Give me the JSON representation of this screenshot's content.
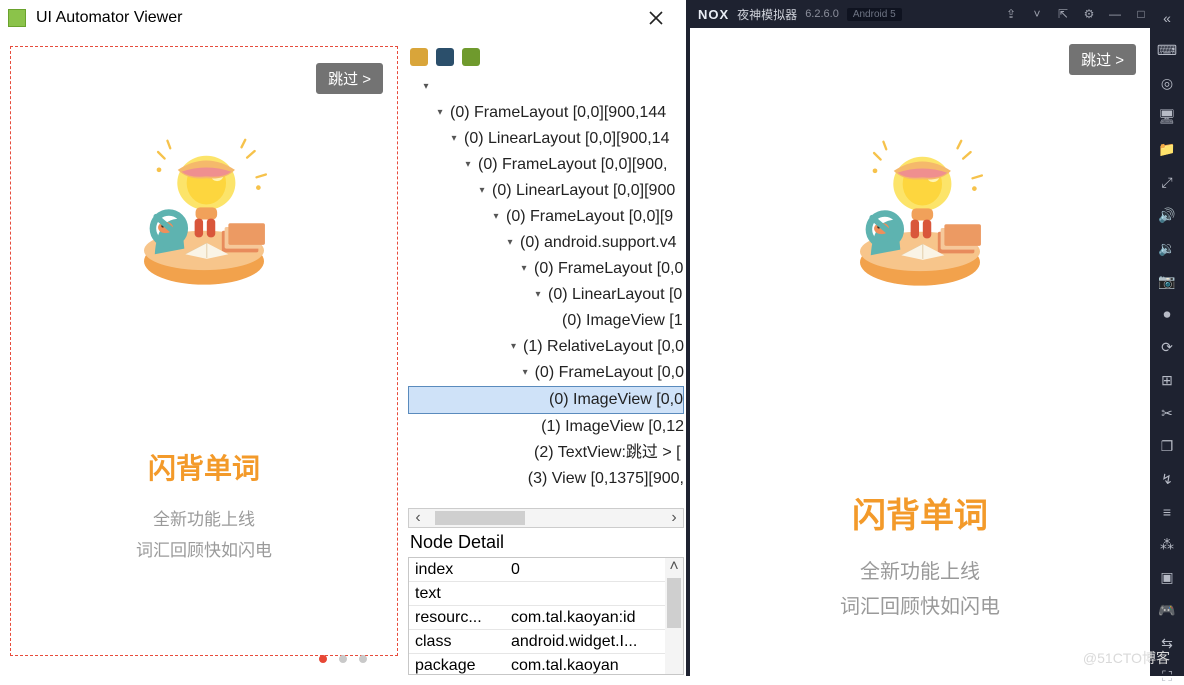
{
  "uiav": {
    "title": "UI Automator Viewer",
    "tree": [
      {
        "depth": 0,
        "arrow": "▾",
        "label": ""
      },
      {
        "depth": 1,
        "arrow": "▾",
        "label": "(0) FrameLayout [0,0][900,144"
      },
      {
        "depth": 2,
        "arrow": "▾",
        "label": "(0) LinearLayout [0,0][900,14"
      },
      {
        "depth": 3,
        "arrow": "▾",
        "label": "(0) FrameLayout [0,0][900,"
      },
      {
        "depth": 4,
        "arrow": "▾",
        "label": "(0) LinearLayout [0,0][900"
      },
      {
        "depth": 5,
        "arrow": "▾",
        "label": "(0) FrameLayout [0,0][9"
      },
      {
        "depth": 6,
        "arrow": "▾",
        "label": "(0) android.support.v4"
      },
      {
        "depth": 7,
        "arrow": "▾",
        "label": "(0) FrameLayout [0,0"
      },
      {
        "depth": 8,
        "arrow": "▾",
        "label": "(0) LinearLayout [0"
      },
      {
        "depth": 9,
        "arrow": "",
        "label": "(0) ImageView [1"
      },
      {
        "depth": 7,
        "arrow": "▾",
        "label": "(1) RelativeLayout [0,0"
      },
      {
        "depth": 8,
        "arrow": "▾",
        "label": "(0) FrameLayout [0,0"
      },
      {
        "depth": 9,
        "arrow": "",
        "label": "(0) ImageView [0,0",
        "selected": true
      },
      {
        "depth": 8,
        "arrow": "",
        "label": "(1) ImageView [0,12"
      },
      {
        "depth": 7,
        "arrow": "",
        "label": "(2) TextView:跳过 >  ["
      },
      {
        "depth": 7,
        "arrow": "",
        "label": "(3) View [0,1375][900,"
      }
    ],
    "node_detail_title": "Node Detail",
    "detail_rows": [
      {
        "k": "index",
        "v": "0"
      },
      {
        "k": "text",
        "v": ""
      },
      {
        "k": "resourc...",
        "v": "com.tal.kaoyan:id"
      },
      {
        "k": "class",
        "v": "android.widget.I..."
      },
      {
        "k": "package",
        "v": "com.tal.kaoyan"
      }
    ]
  },
  "app": {
    "skip_label": "跳过 >",
    "title": "闪背单词",
    "sub1": "全新功能上线",
    "sub2": "词汇回顾快如闪电"
  },
  "nox": {
    "logo": "NOX",
    "name": "夜神模拟器",
    "version": "6.2.6.0",
    "tag": "Android 5"
  },
  "watermark": "@51CTO博客"
}
